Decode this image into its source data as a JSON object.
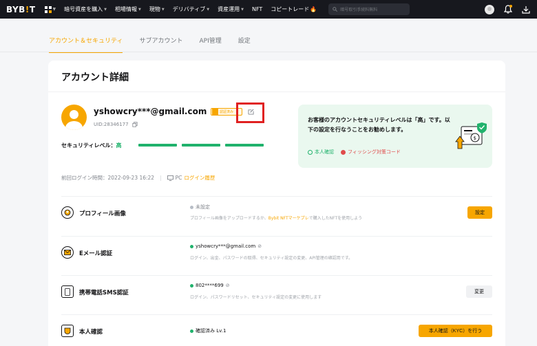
{
  "nav": {
    "logo_main": "BYB",
    "logo_accent": "!",
    "logo_end": "T",
    "items": [
      "暗号資産を購入",
      "相場情報",
      "現物",
      "デリバティブ",
      "資産運用",
      "NFT",
      "コピートレード"
    ],
    "search_placeholder": "暗号取引手続料無料"
  },
  "tabs": [
    "アカウント＆セキュリティ",
    "サブアカウント",
    "API管理",
    "設定"
  ],
  "card": {
    "title": "アカウント詳細",
    "email": "yshowcry***@gmail.com",
    "badge": "認証済み",
    "uid": "UID:28346177",
    "security_label": "セキュリティレベル：",
    "security_level": "高",
    "security_bars_filled": 3,
    "info": {
      "text": "お客様のアカウントセキュリティレベルは「高」です。以下の設定を行なうことをお勧めします。",
      "link_ok": "本人確認",
      "link_ng": "フィッシング対策コード"
    },
    "last_login_label": "前回ログイン時間：2022-09-23 16:22",
    "last_login_device": "PC",
    "last_login_history": "ログイン履歴"
  },
  "rows": [
    {
      "label": "プロフィール画像",
      "status": "未設定",
      "desc_before": "プロフィール画像をアップロードするか、",
      "desc_highlight": "Bybit NFTマーケプレ",
      "desc_after": "で購入したNFTを使用しよう",
      "button": "設定"
    },
    {
      "label": "Eメール認証",
      "status": "yshowcry***@gmail.com",
      "desc": "ログイン、出金、パスワードの取得、セキュリティ設定の変更、API管理の確認用です。",
      "button": ""
    },
    {
      "label": "携帯電話SMS認証",
      "status": "802****699",
      "desc": "ログイン、パスワードリセット、セキュリティ設定の変更に使用します",
      "button": "変更"
    },
    {
      "label": "本人確認",
      "status": "確認済み Lv.1",
      "button": "本人確認（KYC）を行う"
    }
  ],
  "colors": {
    "accent": "#f7a600",
    "success": "#20b26c",
    "danger": "#e04b4b",
    "nav_bg": "#17181e"
  }
}
